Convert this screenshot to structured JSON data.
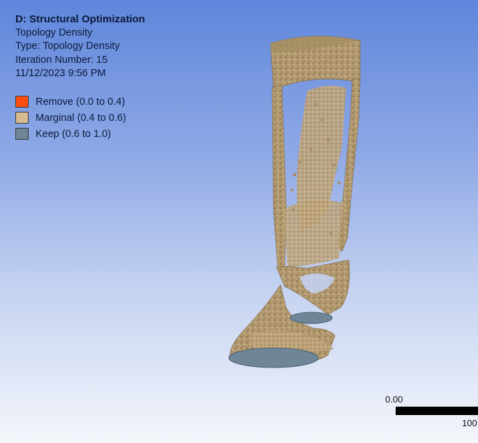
{
  "info": {
    "title": "D: Structural Optimization",
    "result": "Topology Density",
    "type": "Type: Topology Density",
    "iteration": "Iteration Number: 15",
    "datetime": "11/12/2023 9:56 PM"
  },
  "legend": [
    {
      "label": "Remove (0.0 to 0.4)",
      "color": "#ff4e0e"
    },
    {
      "label": "Marginal (0.4 to 0.6)",
      "color": "#d8bc91"
    },
    {
      "label": "Keep (0.6 to 1.0)",
      "color": "#6f8598"
    }
  ],
  "scale_bar": {
    "start": "0.00",
    "end": "100"
  },
  "colors": {
    "background_top": "#5f86db",
    "background_bottom": "#f4f6fb",
    "material": "#b39a70",
    "material_light": "#c9b28a",
    "keep_face": "#6f8598"
  }
}
